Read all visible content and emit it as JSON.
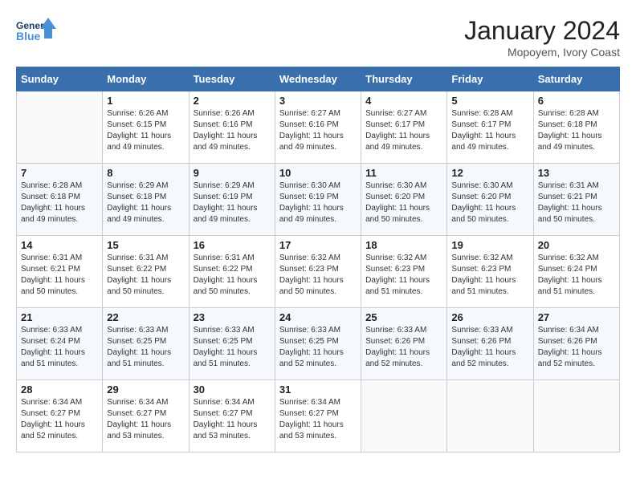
{
  "header": {
    "logo_line1": "General",
    "logo_line2": "Blue",
    "title": "January 2024",
    "subtitle": "Mopoyem, Ivory Coast"
  },
  "weekdays": [
    "Sunday",
    "Monday",
    "Tuesday",
    "Wednesday",
    "Thursday",
    "Friday",
    "Saturday"
  ],
  "weeks": [
    [
      {
        "day": "",
        "sunrise": "",
        "sunset": "",
        "daylight": ""
      },
      {
        "day": "1",
        "sunrise": "6:26 AM",
        "sunset": "6:15 PM",
        "daylight": "11 hours and 49 minutes."
      },
      {
        "day": "2",
        "sunrise": "6:26 AM",
        "sunset": "6:16 PM",
        "daylight": "11 hours and 49 minutes."
      },
      {
        "day": "3",
        "sunrise": "6:27 AM",
        "sunset": "6:16 PM",
        "daylight": "11 hours and 49 minutes."
      },
      {
        "day": "4",
        "sunrise": "6:27 AM",
        "sunset": "6:17 PM",
        "daylight": "11 hours and 49 minutes."
      },
      {
        "day": "5",
        "sunrise": "6:28 AM",
        "sunset": "6:17 PM",
        "daylight": "11 hours and 49 minutes."
      },
      {
        "day": "6",
        "sunrise": "6:28 AM",
        "sunset": "6:18 PM",
        "daylight": "11 hours and 49 minutes."
      }
    ],
    [
      {
        "day": "7",
        "sunrise": "6:28 AM",
        "sunset": "6:18 PM",
        "daylight": "11 hours and 49 minutes."
      },
      {
        "day": "8",
        "sunrise": "6:29 AM",
        "sunset": "6:18 PM",
        "daylight": "11 hours and 49 minutes."
      },
      {
        "day": "9",
        "sunrise": "6:29 AM",
        "sunset": "6:19 PM",
        "daylight": "11 hours and 49 minutes."
      },
      {
        "day": "10",
        "sunrise": "6:30 AM",
        "sunset": "6:19 PM",
        "daylight": "11 hours and 49 minutes."
      },
      {
        "day": "11",
        "sunrise": "6:30 AM",
        "sunset": "6:20 PM",
        "daylight": "11 hours and 50 minutes."
      },
      {
        "day": "12",
        "sunrise": "6:30 AM",
        "sunset": "6:20 PM",
        "daylight": "11 hours and 50 minutes."
      },
      {
        "day": "13",
        "sunrise": "6:31 AM",
        "sunset": "6:21 PM",
        "daylight": "11 hours and 50 minutes."
      }
    ],
    [
      {
        "day": "14",
        "sunrise": "6:31 AM",
        "sunset": "6:21 PM",
        "daylight": "11 hours and 50 minutes."
      },
      {
        "day": "15",
        "sunrise": "6:31 AM",
        "sunset": "6:22 PM",
        "daylight": "11 hours and 50 minutes."
      },
      {
        "day": "16",
        "sunrise": "6:31 AM",
        "sunset": "6:22 PM",
        "daylight": "11 hours and 50 minutes."
      },
      {
        "day": "17",
        "sunrise": "6:32 AM",
        "sunset": "6:23 PM",
        "daylight": "11 hours and 50 minutes."
      },
      {
        "day": "18",
        "sunrise": "6:32 AM",
        "sunset": "6:23 PM",
        "daylight": "11 hours and 51 minutes."
      },
      {
        "day": "19",
        "sunrise": "6:32 AM",
        "sunset": "6:23 PM",
        "daylight": "11 hours and 51 minutes."
      },
      {
        "day": "20",
        "sunrise": "6:32 AM",
        "sunset": "6:24 PM",
        "daylight": "11 hours and 51 minutes."
      }
    ],
    [
      {
        "day": "21",
        "sunrise": "6:33 AM",
        "sunset": "6:24 PM",
        "daylight": "11 hours and 51 minutes."
      },
      {
        "day": "22",
        "sunrise": "6:33 AM",
        "sunset": "6:25 PM",
        "daylight": "11 hours and 51 minutes."
      },
      {
        "day": "23",
        "sunrise": "6:33 AM",
        "sunset": "6:25 PM",
        "daylight": "11 hours and 51 minutes."
      },
      {
        "day": "24",
        "sunrise": "6:33 AM",
        "sunset": "6:25 PM",
        "daylight": "11 hours and 52 minutes."
      },
      {
        "day": "25",
        "sunrise": "6:33 AM",
        "sunset": "6:26 PM",
        "daylight": "11 hours and 52 minutes."
      },
      {
        "day": "26",
        "sunrise": "6:33 AM",
        "sunset": "6:26 PM",
        "daylight": "11 hours and 52 minutes."
      },
      {
        "day": "27",
        "sunrise": "6:34 AM",
        "sunset": "6:26 PM",
        "daylight": "11 hours and 52 minutes."
      }
    ],
    [
      {
        "day": "28",
        "sunrise": "6:34 AM",
        "sunset": "6:27 PM",
        "daylight": "11 hours and 52 minutes."
      },
      {
        "day": "29",
        "sunrise": "6:34 AM",
        "sunset": "6:27 PM",
        "daylight": "11 hours and 53 minutes."
      },
      {
        "day": "30",
        "sunrise": "6:34 AM",
        "sunset": "6:27 PM",
        "daylight": "11 hours and 53 minutes."
      },
      {
        "day": "31",
        "sunrise": "6:34 AM",
        "sunset": "6:27 PM",
        "daylight": "11 hours and 53 minutes."
      },
      {
        "day": "",
        "sunrise": "",
        "sunset": "",
        "daylight": ""
      },
      {
        "day": "",
        "sunrise": "",
        "sunset": "",
        "daylight": ""
      },
      {
        "day": "",
        "sunrise": "",
        "sunset": "",
        "daylight": ""
      }
    ]
  ]
}
